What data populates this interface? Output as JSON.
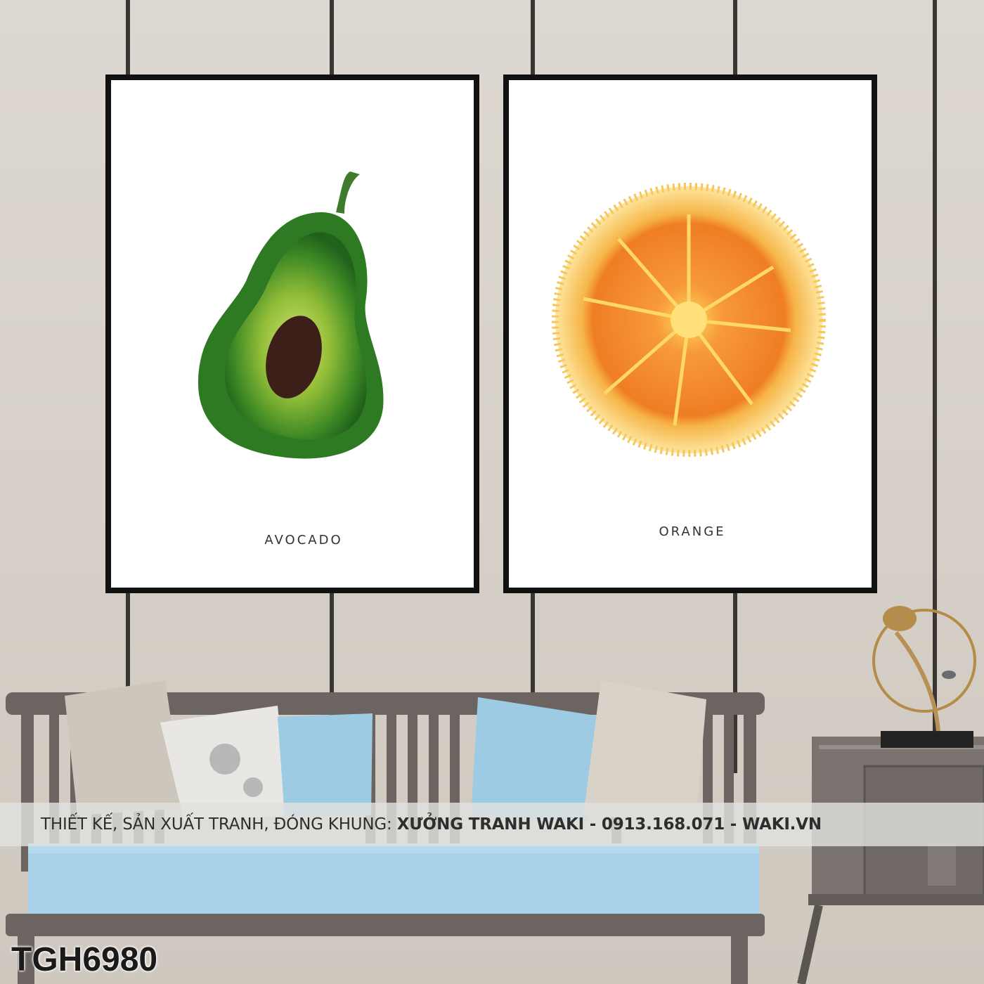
{
  "posters": [
    {
      "title": "AVOCADO"
    },
    {
      "title": "ORANGE"
    }
  ],
  "banner": {
    "prefix": "THIẾT KẾ, SẢN XUẤT TRANH, ĐÓNG KHUNG:",
    "brand": "XƯỞNG TRANH WAKI - 0913.168.071  -  WAKI.VN"
  },
  "product_code": "TGH6980",
  "colors": {
    "wall": "#d9d3cb",
    "frame": "#111111",
    "sofa": "#6b6460",
    "cushion_blue": "#9ccbe3",
    "seat": "#a9d2e8"
  }
}
